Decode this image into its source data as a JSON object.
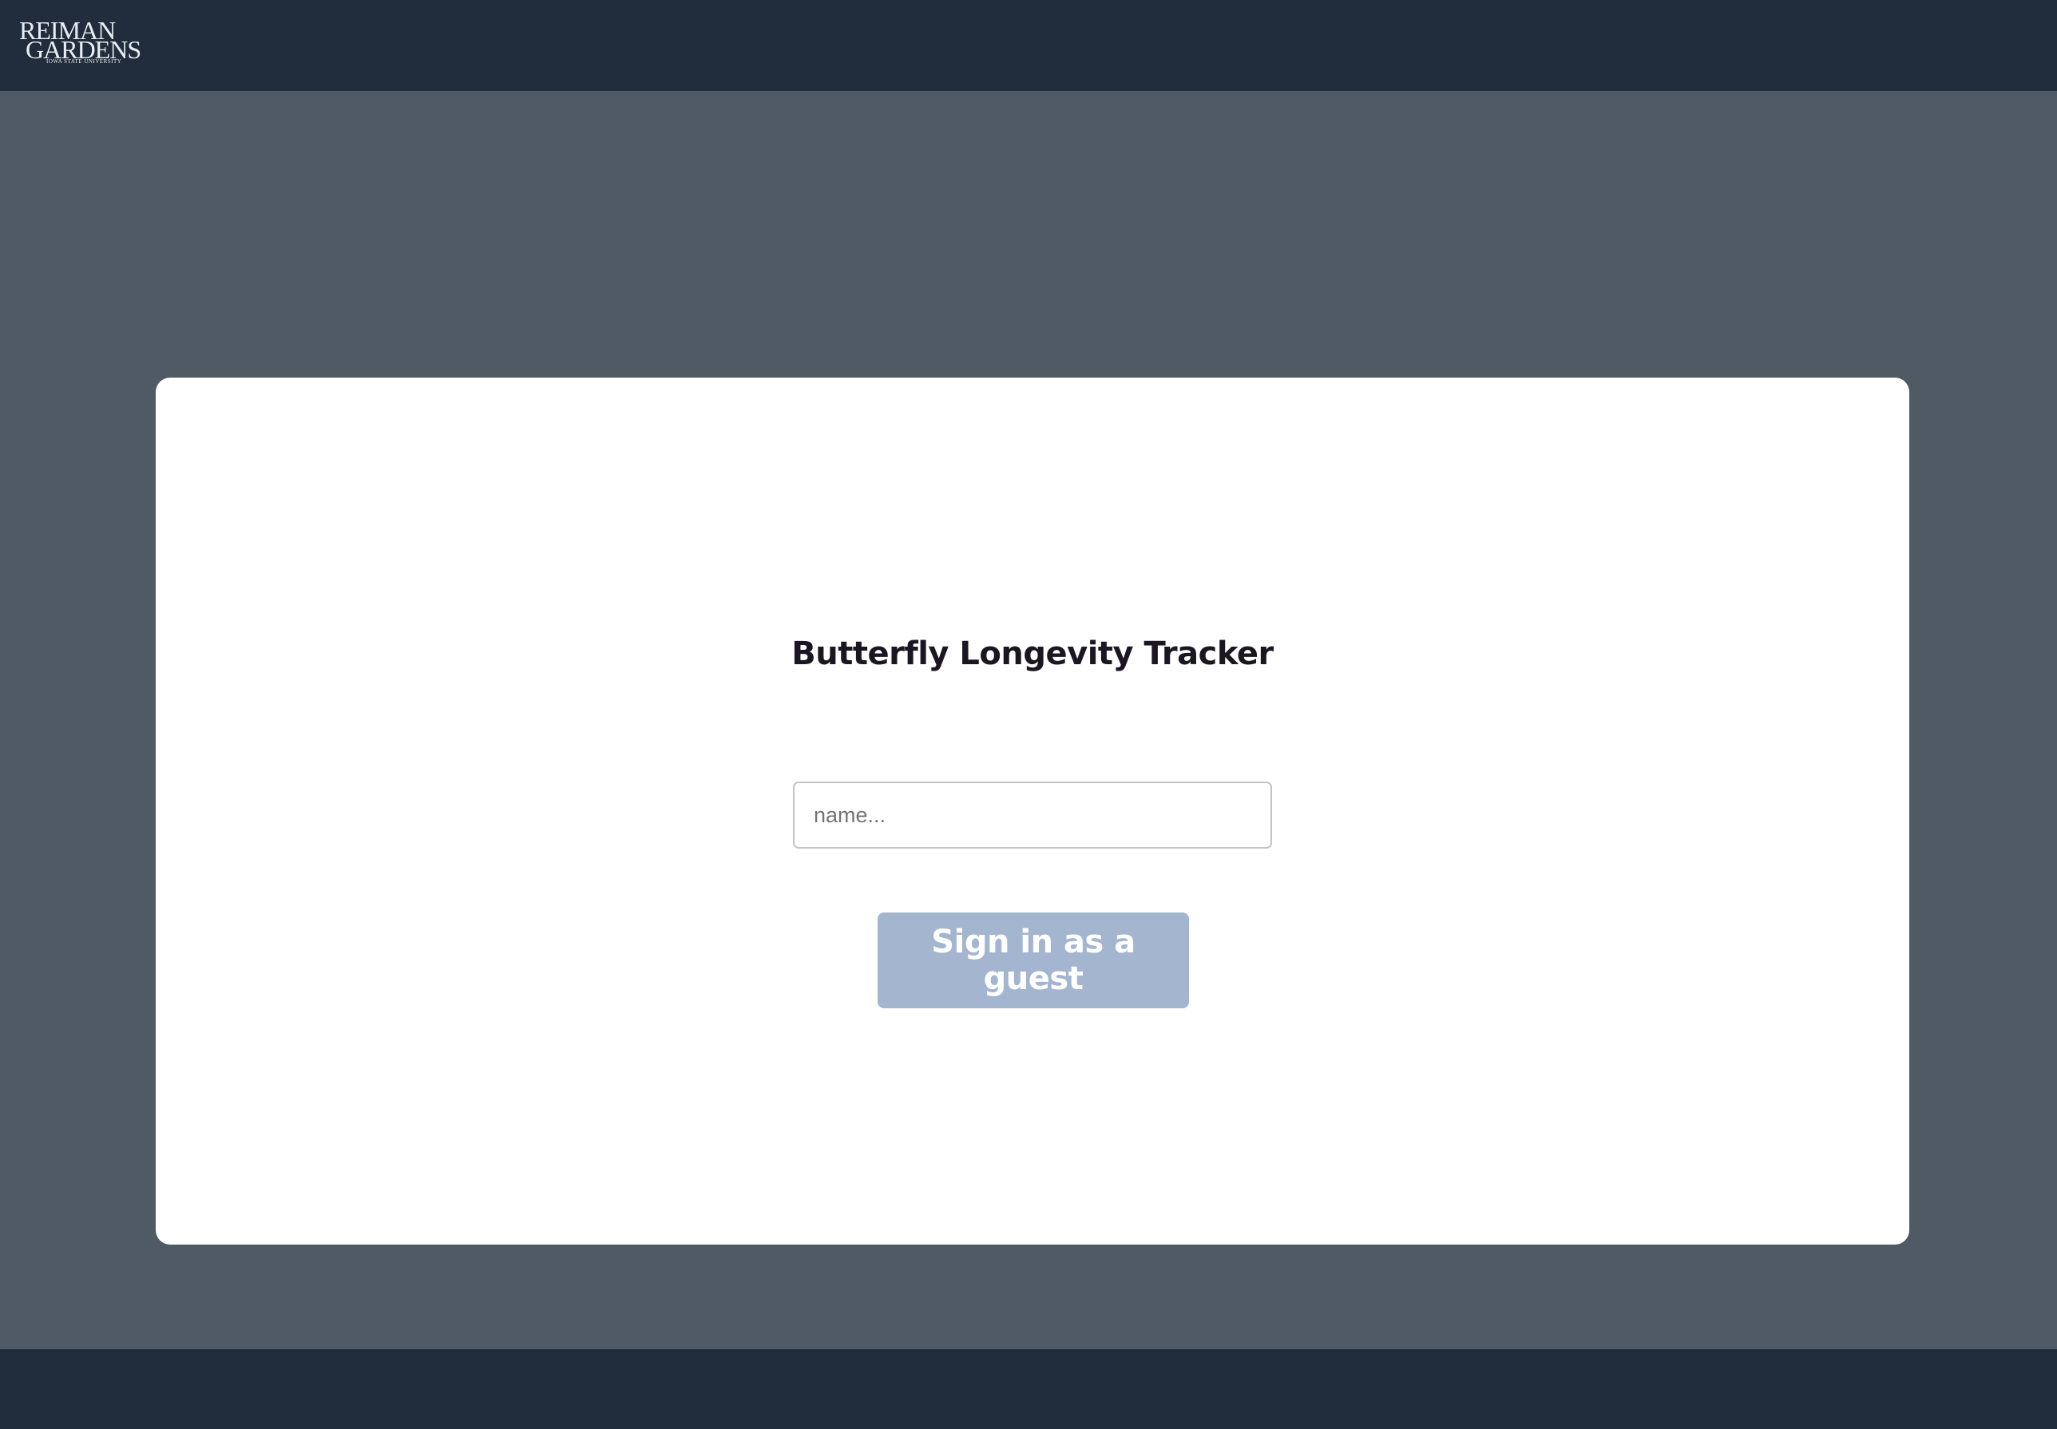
{
  "header": {
    "logo": {
      "line1": "REIMAN",
      "line2": "GARDENS",
      "subtitle": "IOWA STATE UNIVERSITY",
      "icon": "reiman-gardens-logo"
    }
  },
  "login_card": {
    "title": "Butterfly Longevity Tracker",
    "name_input": {
      "placeholder": "name...",
      "value": ""
    },
    "guest_button_label": "Sign in as a guest"
  },
  "colors": {
    "header_bg": "#212d3c",
    "page_bg": "#4f5a65",
    "card_bg": "#ffffff",
    "button_bg": "#a4b5cf",
    "title_text": "#1b1622"
  }
}
